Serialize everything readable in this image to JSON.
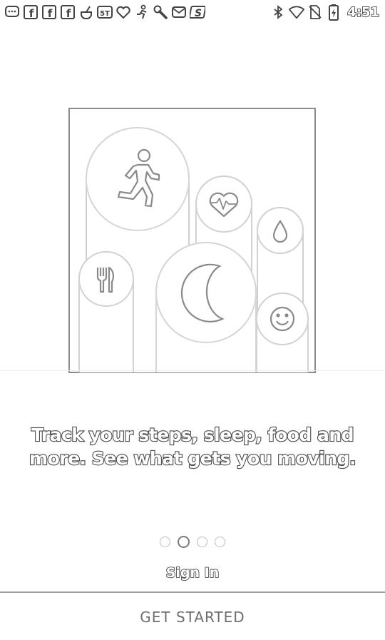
{
  "status_bar": {
    "notifications": [
      {
        "icon": "chat-bubble-icon"
      },
      {
        "icon": "facebook-icon",
        "label": "f"
      },
      {
        "icon": "facebook-icon",
        "label": "f"
      },
      {
        "icon": "facebook-icon",
        "label": "f"
      },
      {
        "icon": "pot-icon"
      },
      {
        "icon": "5t-app-icon",
        "label": "5T"
      },
      {
        "icon": "heart-icon"
      },
      {
        "icon": "person-exercise-icon"
      },
      {
        "icon": "wrench-icon"
      },
      {
        "icon": "mail-icon"
      },
      {
        "icon": "s-app-icon",
        "label": "S"
      }
    ],
    "system_icons": [
      "bluetooth-icon",
      "wifi-icon",
      "no-sim-icon",
      "battery-icon"
    ],
    "time": "4:51"
  },
  "illustration": {
    "icons": [
      "walking-person-icon",
      "heart-rate-icon",
      "water-drop-icon",
      "fork-knife-icon",
      "moon-icon",
      "smiley-icon"
    ]
  },
  "tagline": {
    "line1": "Track your steps, sleep, food and",
    "line2": "more. See what gets you moving."
  },
  "pager": {
    "count": 4,
    "active_index": 1
  },
  "actions": {
    "sign_in": "Sign In",
    "get_started": "GET STARTED"
  }
}
